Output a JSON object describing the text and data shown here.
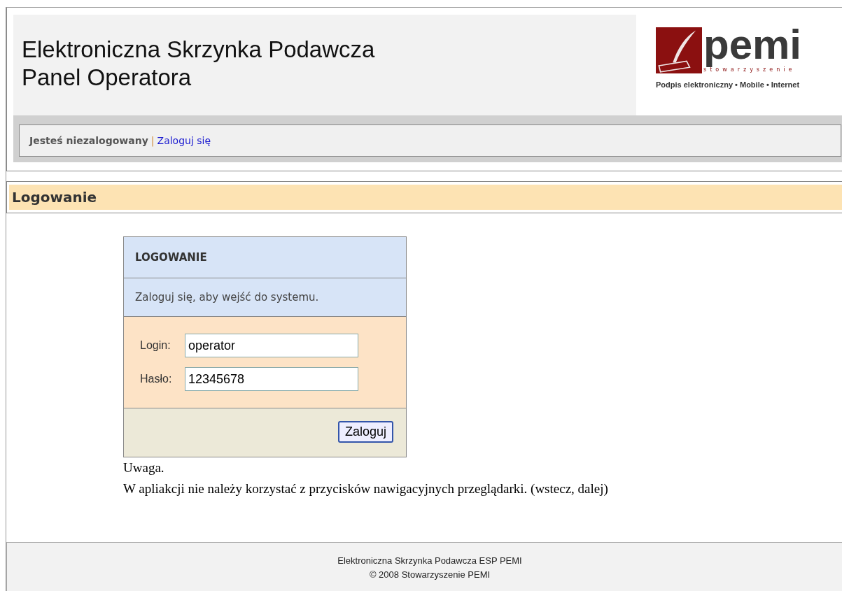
{
  "header": {
    "title_lines": [
      "Elektroniczna Skrzynka Podawcza",
      "Panel Operatora"
    ],
    "logo": {
      "name": "pemi",
      "subtitle": "stowarzyszenie",
      "tagline": "Podpis elektroniczny • Mobile • Internet"
    }
  },
  "nav": {
    "status": "Jesteś niezalogowany",
    "separator": "|",
    "link": "Zaloguj się"
  },
  "section_title": "Logowanie",
  "login_box": {
    "title": "LOGOWANIE",
    "message": "Zaloguj się, aby wejść do systemu.",
    "fields": [
      {
        "label": "Login:",
        "value": "operator"
      },
      {
        "label": "Hasło:",
        "value": "12345678"
      }
    ],
    "button": "Zaloguj"
  },
  "notice": [
    "Uwaga.",
    "W apliakcji nie należy korzystać z przycisków nawigacyjnych przeglądarki. (wstecz, dalej)"
  ],
  "footer": [
    "Elektroniczna Skrzynka Podawcza ESP PEMI",
    "© 2008 Stowarzyszenie PEMI"
  ]
}
